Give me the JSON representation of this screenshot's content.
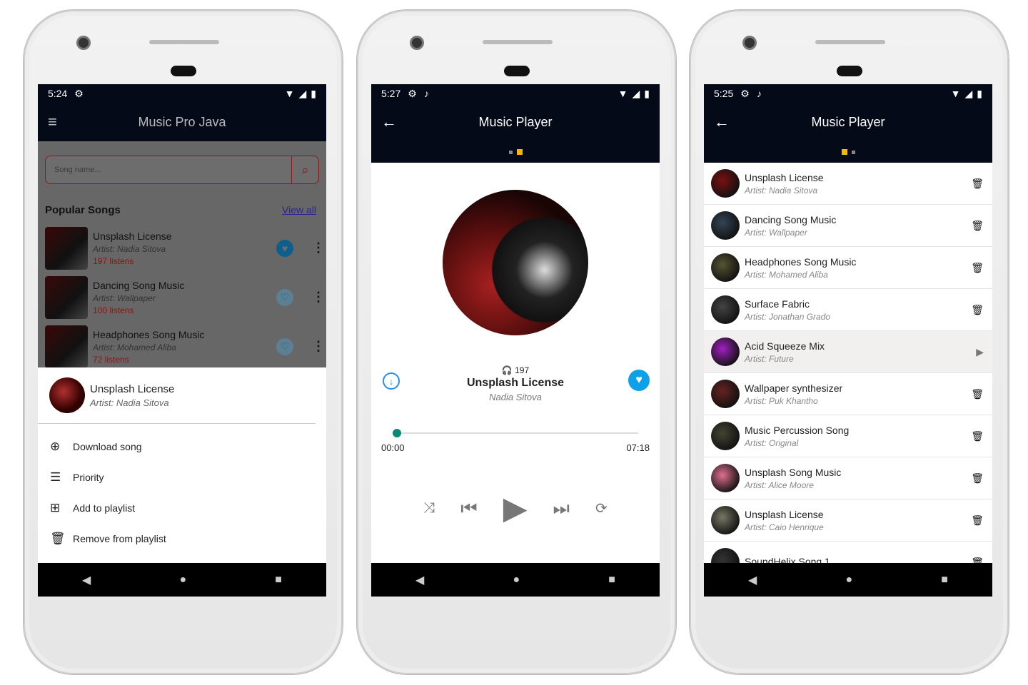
{
  "phone1": {
    "status": {
      "time": "5:24"
    },
    "title": "Music Pro Java",
    "search": {
      "placeholder": "Song name..."
    },
    "section_title": "Popular Songs",
    "view_all": "View all",
    "songs": [
      {
        "title": "Unsplash License",
        "artist_label": "Artist:",
        "artist": "Nadia Sitova",
        "listens": "197 listens",
        "liked": true
      },
      {
        "title": "Dancing Song Music",
        "artist_label": "Artist:",
        "artist": "Wallpaper",
        "listens": "100 listens",
        "liked": false
      },
      {
        "title": "Headphones Song Music",
        "artist_label": "Artist:",
        "artist": "Mohamed Aliba",
        "listens": "72 listens",
        "liked": false
      }
    ],
    "sheet": {
      "title": "Unsplash License",
      "artist": "Artist:  Nadia Sitova",
      "options": [
        {
          "label": "Download song",
          "icon": "download-icon"
        },
        {
          "label": "Priority",
          "icon": "priority-icon"
        },
        {
          "label": "Add to playlist",
          "icon": "playlist-add-icon"
        },
        {
          "label": "Remove from playlist",
          "icon": "delete-icon"
        }
      ]
    }
  },
  "phone2": {
    "status": {
      "time": "5:27"
    },
    "title": "Music Player",
    "listens": "197",
    "song": "Unsplash License",
    "artist": "Nadia Sitova",
    "elapsed": "00:00",
    "duration": "07:18",
    "progress": 0,
    "liked": true
  },
  "phone3": {
    "status": {
      "time": "5:25"
    },
    "title": "Music Player",
    "songs": [
      {
        "title": "Unsplash License",
        "artist": "Artist:  Nadia Sitova"
      },
      {
        "title": "Dancing Song Music",
        "artist": "Artist:  Wallpaper"
      },
      {
        "title": "Headphones Song Music",
        "artist": "Artist:  Mohamed Aliba"
      },
      {
        "title": "Surface Fabric",
        "artist": "Artist:  Jonathan Grado"
      },
      {
        "title": "Acid Squeeze Mix",
        "artist": "Artist:  Future",
        "playing": true
      },
      {
        "title": "Wallpaper synthesizer",
        "artist": "Artist:  Puk Khantho"
      },
      {
        "title": "Music Percussion Song",
        "artist": "Artist:  Original"
      },
      {
        "title": "Unsplash Song Music",
        "artist": "Artist:  Alice Moore"
      },
      {
        "title": "Unsplash License",
        "artist": "Artist:  Caio Henrique"
      },
      {
        "title": "SoundHelix Song 1",
        "artist": ""
      }
    ]
  },
  "colors": {
    "appbar": "#040a18",
    "accent_red": "#d02020",
    "like_blue": "#1a9be0",
    "progress": "#0a8a74",
    "page_dot": "#f5b800"
  }
}
